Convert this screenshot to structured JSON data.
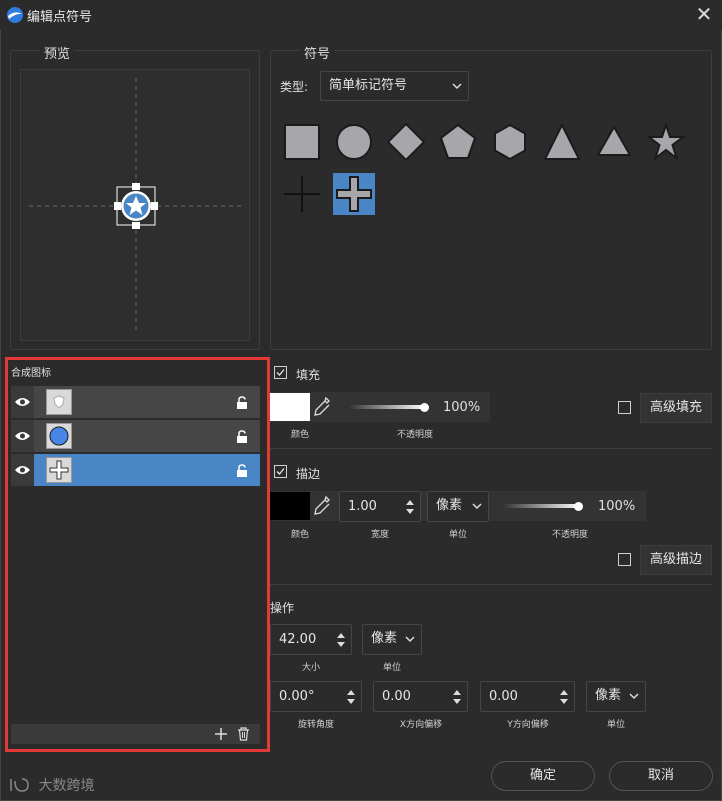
{
  "window": {
    "title": "编辑点符号",
    "close_icon": "close-icon"
  },
  "preview": {
    "title": "预览"
  },
  "symbol": {
    "title": "符号",
    "type_label": "类型:",
    "type_value": "简单标记符号",
    "shapes": [
      "square",
      "circle",
      "diamond",
      "pentagon",
      "hexagon",
      "triangle",
      "triangle-small",
      "star",
      "cross-thin",
      "cross"
    ],
    "selected_shape": "cross"
  },
  "fill": {
    "checkbox_label": "填充",
    "checked": true,
    "color_label": "颜色",
    "color_value": "#ffffff",
    "opacity_value": "100%",
    "opacity_level": 1.0,
    "opacity_label": "不透明度",
    "advanced_checked": false,
    "advanced_label": "高级填充"
  },
  "stroke": {
    "checkbox_label": "描边",
    "checked": true,
    "color_label": "颜色",
    "color_value": "#000000",
    "width_value": "1.00",
    "width_label": "宽度",
    "unit_value": "像素",
    "unit_label": "单位",
    "opacity_value": "100%",
    "opacity_level": 1.0,
    "opacity_label": "不透明度",
    "advanced_checked": false,
    "advanced_label": "高级描边"
  },
  "operation": {
    "title": "操作",
    "size_value": "42.00",
    "size_label": "大小",
    "size_unit_value": "像素",
    "size_unit_label": "单位",
    "rotation_value": "0.00°",
    "rotation_label": "旋转角度",
    "x_offset_value": "0.00",
    "x_offset_label": "X方向偏移",
    "y_offset_value": "0.00",
    "y_offset_label": "Y方向偏移",
    "offset_unit_value": "像素",
    "offset_unit_label": "单位"
  },
  "layers": {
    "title": "合成图标",
    "items": [
      {
        "visible": true,
        "thumbnail": "shield-star-thumbnail",
        "locked": false
      },
      {
        "visible": true,
        "thumbnail": "blue-circle-thumbnail",
        "locked": false
      },
      {
        "visible": true,
        "thumbnail": "cross-thumbnail",
        "locked": false,
        "selected": true
      }
    ]
  },
  "footer": {
    "ok_label": "确定",
    "cancel_label": "取消",
    "watermark": "大数跨境"
  },
  "colors": {
    "accent": "#4a86c6",
    "highlight_border": "#e53935",
    "background": "#2b2b2b"
  }
}
